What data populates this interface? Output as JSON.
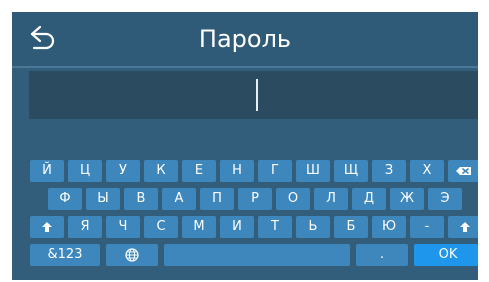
{
  "header": {
    "title": "Пароль",
    "back_icon": "back-arrow-icon"
  },
  "password": {
    "value": ""
  },
  "keyboard": {
    "row1": [
      "Й",
      "Ц",
      "У",
      "К",
      "Е",
      "Н",
      "Г",
      "Ш",
      "Щ",
      "З",
      "Х"
    ],
    "row2": [
      "Ф",
      "Ы",
      "В",
      "А",
      "П",
      "Р",
      "О",
      "Л",
      "Д",
      "Ж",
      "Э"
    ],
    "row3": [
      "Я",
      "Ч",
      "С",
      "М",
      "И",
      "Т",
      "Ь",
      "Б",
      "Ю",
      "-"
    ],
    "backspace_icon": "backspace-icon",
    "shift_icon": "shift-icon",
    "globe_icon": "globe-icon",
    "symbols_label": "&123",
    "dot_label": ".",
    "ok_label": "OK"
  },
  "colors": {
    "background": "#325e7b",
    "header": "#2f5b78",
    "field": "#2a4b60",
    "key": "#3d87bd",
    "accent": "#1e96ec",
    "text": "#ffffff"
  }
}
